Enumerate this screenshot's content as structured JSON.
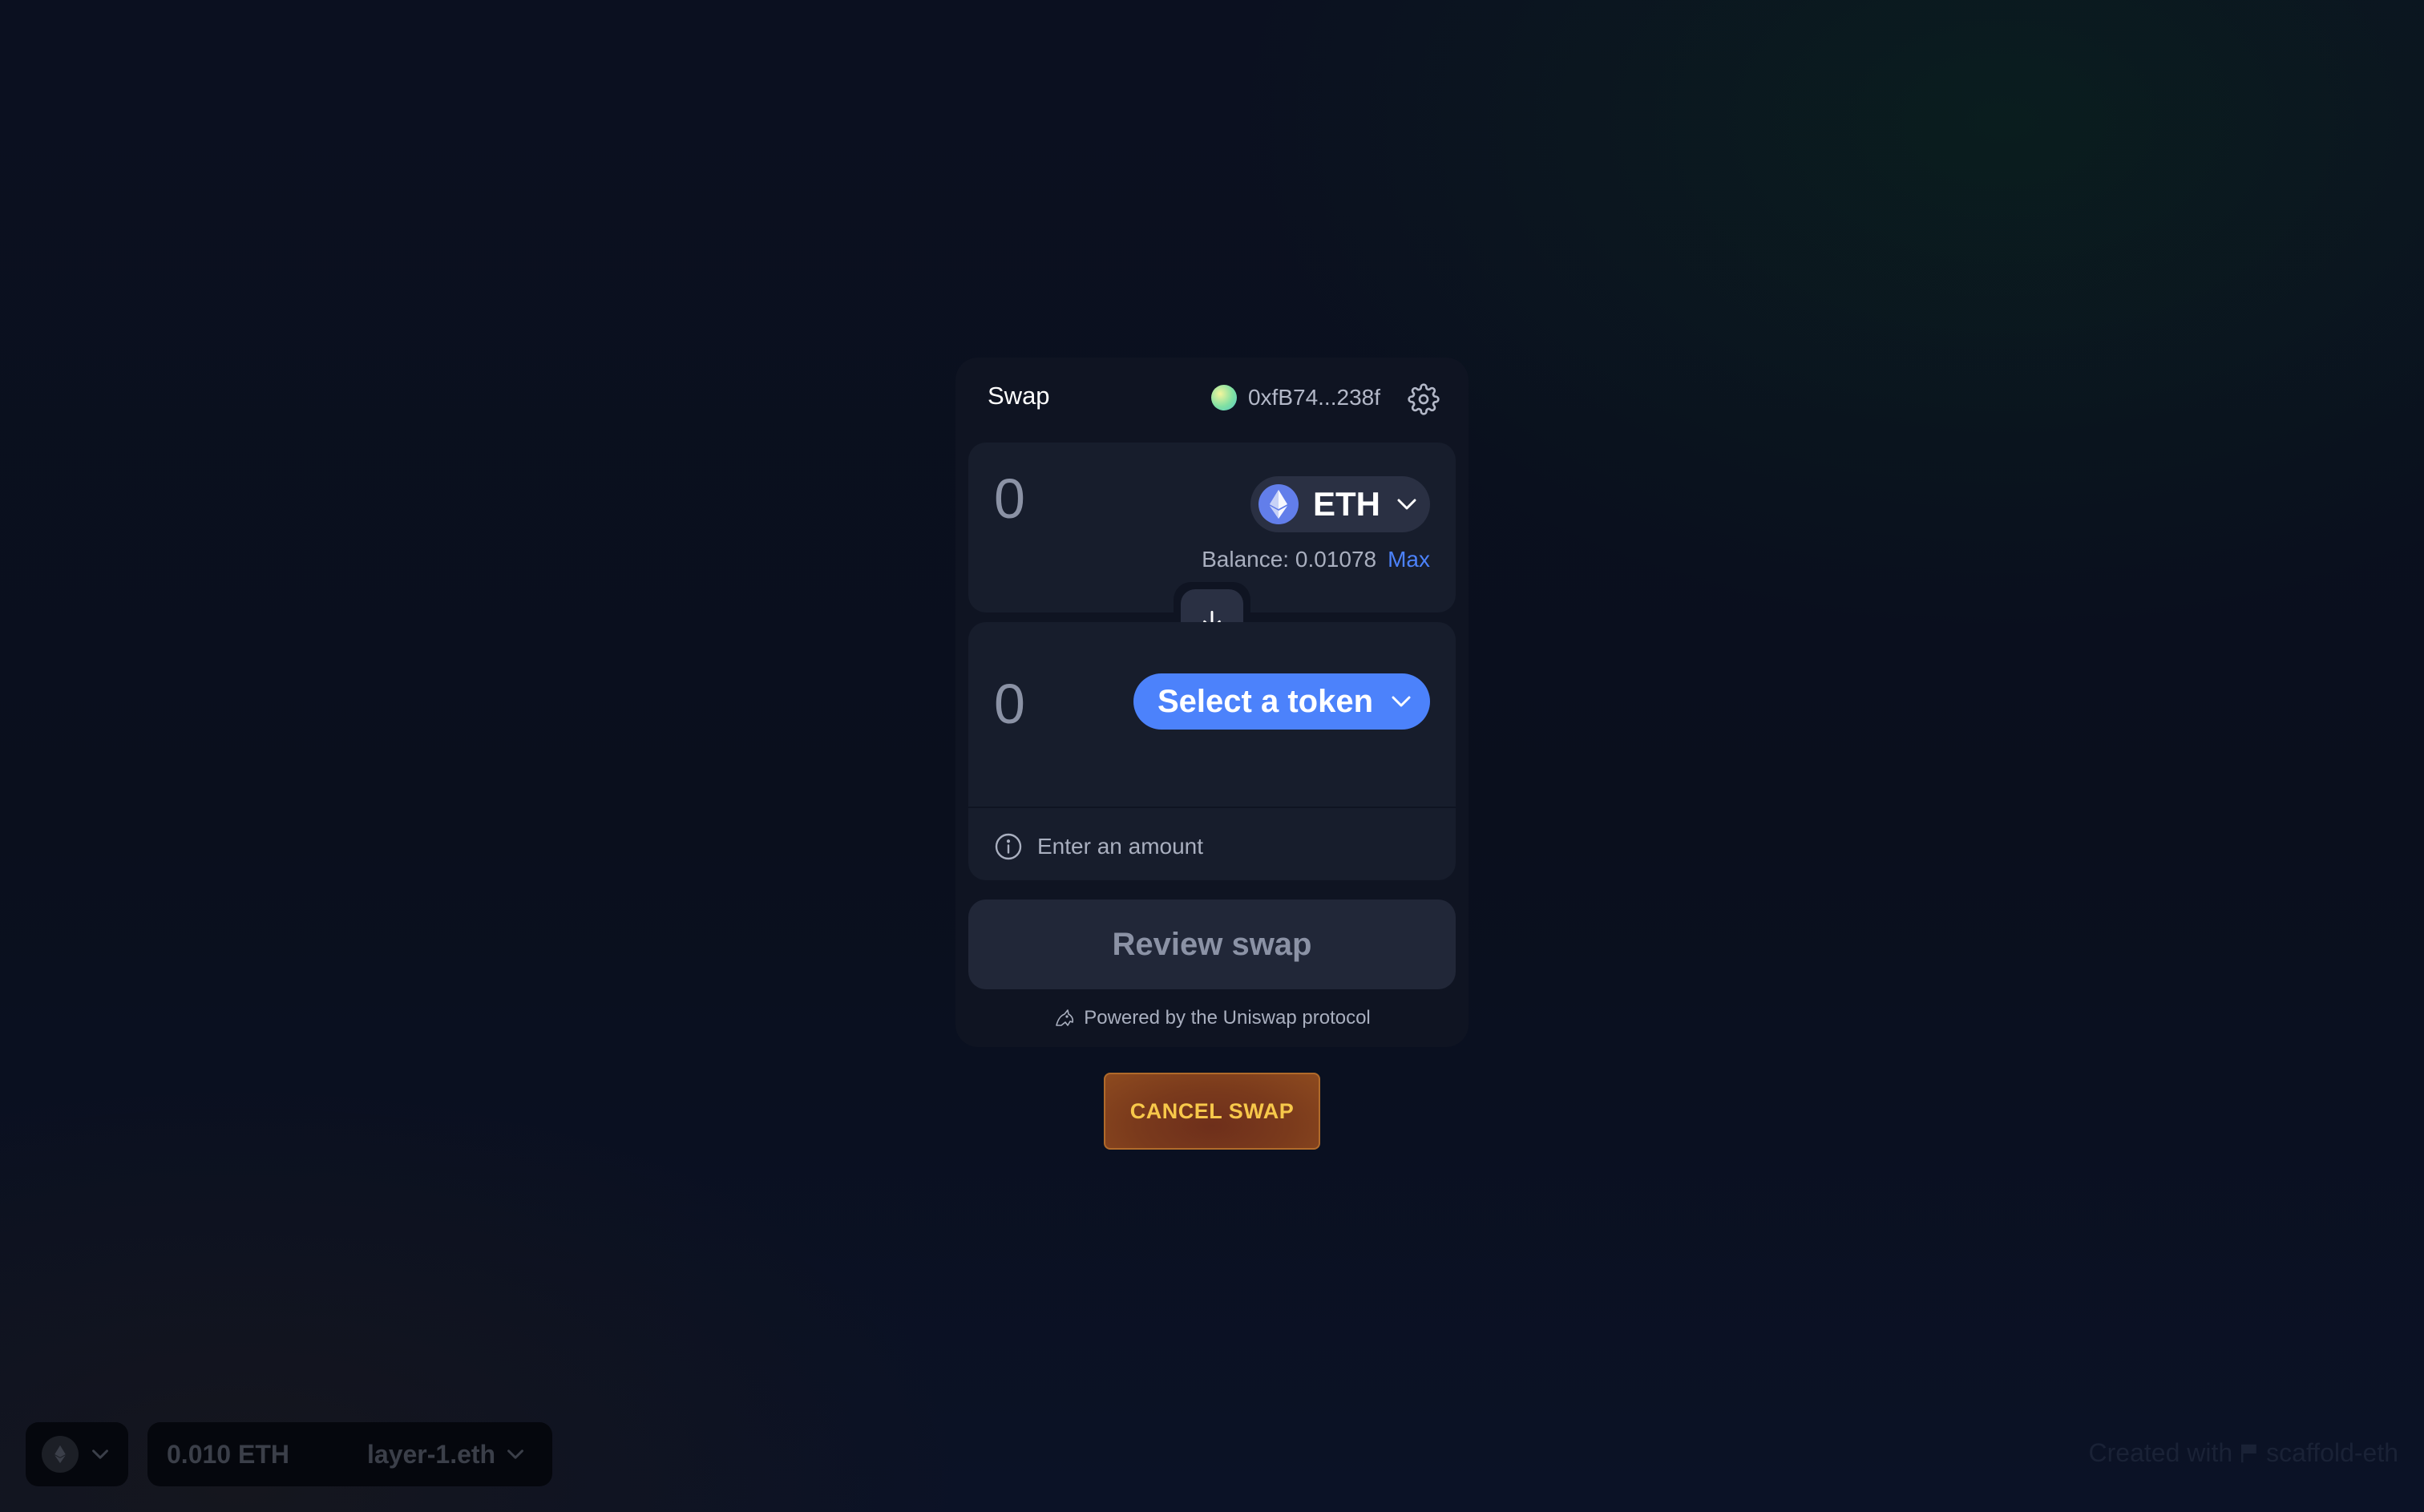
{
  "swap": {
    "title": "Swap",
    "account_address": "0xfB74...238f",
    "input": {
      "amount": "0",
      "token": "ETH",
      "balance_label": "Balance: 0.01078",
      "max_label": "Max"
    },
    "output": {
      "amount": "0",
      "token_placeholder": "Select a token"
    },
    "info_text": "Enter an amount",
    "review_label": "Review swap",
    "powered_by": "Powered by the Uniswap protocol"
  },
  "cancel_label": "CANCEL SWAP",
  "footer": {
    "wallet_balance": "0.010 ETH",
    "wallet_ens": "layer-1.eth",
    "created_with_prefix": "Created with",
    "created_with_link": "scaffold-eth"
  },
  "colors": {
    "accent": "#4c82fb",
    "eth": "#627eea",
    "cancel_text": "#f7c84a"
  },
  "icons": {
    "settings": "gear-icon",
    "flip": "arrow-down-icon",
    "info": "info-icon",
    "eth": "ethereum-icon",
    "chevron": "chevron-down-icon",
    "uniswap": "unicorn-icon",
    "flag": "flag-icon"
  }
}
